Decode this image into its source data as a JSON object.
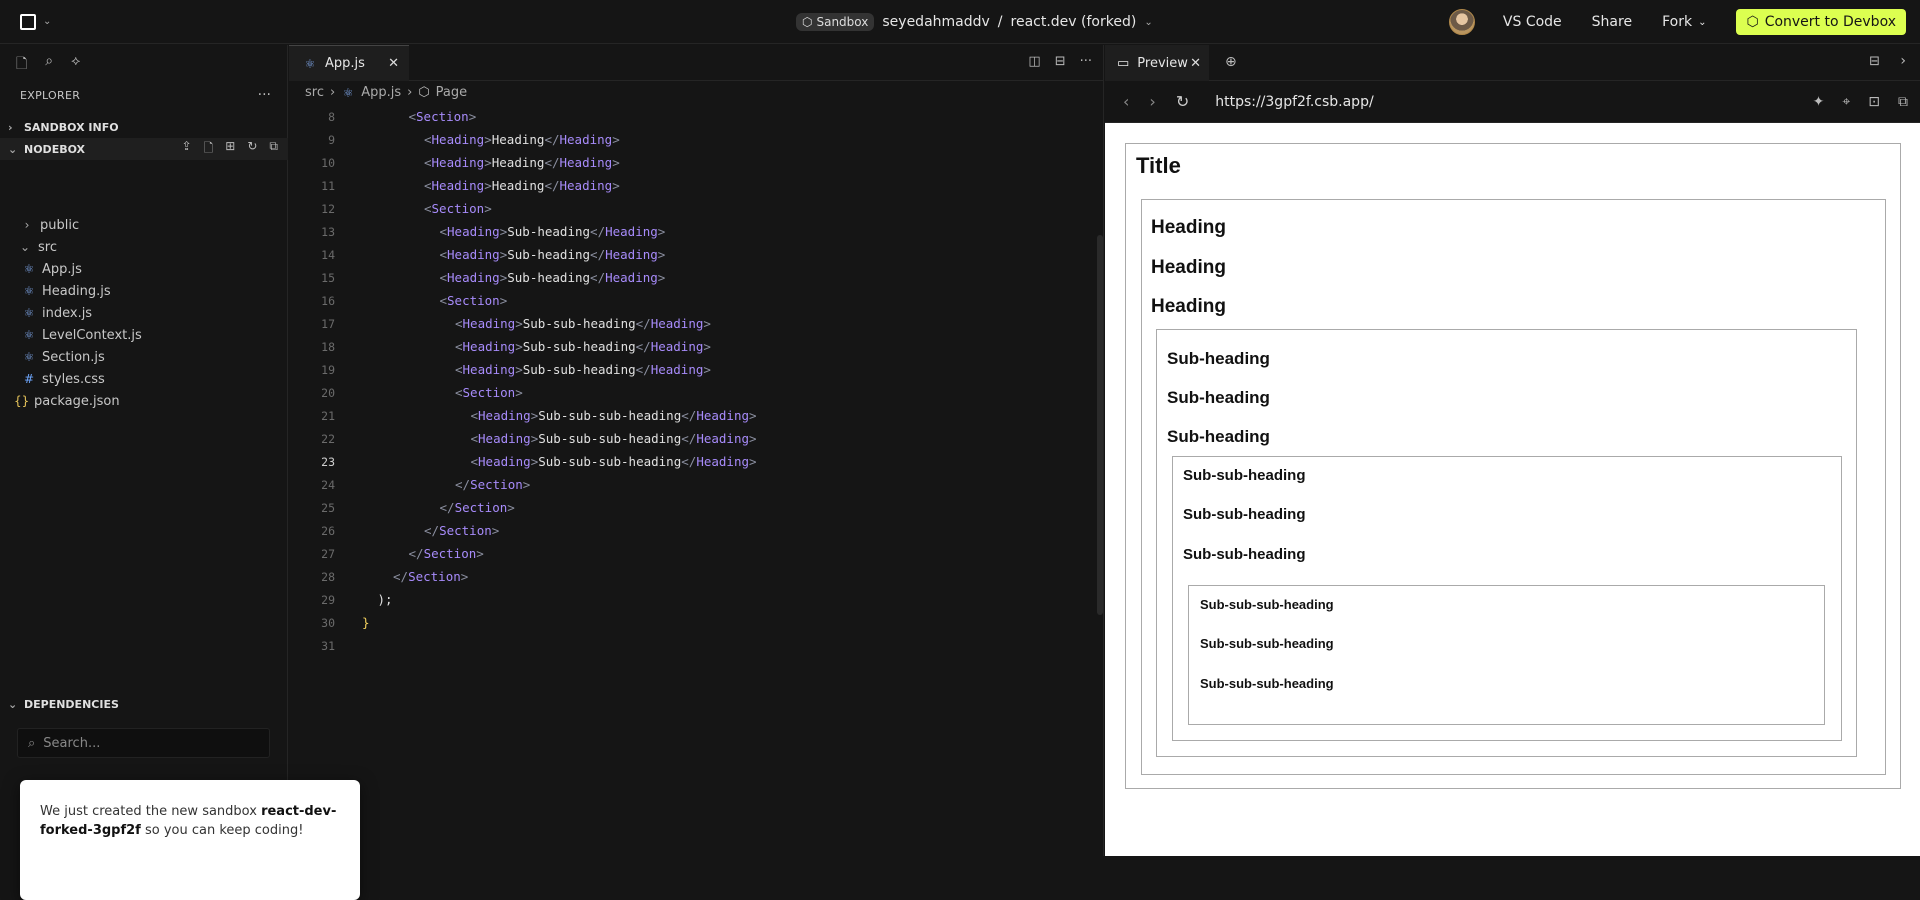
{
  "topbar": {
    "sandbox_label": "Sandbox",
    "owner": "seyedahmaddv",
    "separator": "/",
    "project": "react.dev (forked)",
    "vscode_label": "VS Code",
    "share_label": "Share",
    "fork_label": "Fork",
    "convert_label": "Convert to Devbox"
  },
  "sidebar": {
    "title": "EXPLORER",
    "sandbox_info": "SANDBOX INFO",
    "nodebox": "NODEBOX",
    "tree": [
      {
        "label": "public",
        "kind": "folder"
      },
      {
        "label": "src",
        "kind": "folder-open"
      },
      {
        "label": "App.js",
        "kind": "react"
      },
      {
        "label": "Heading.js",
        "kind": "react"
      },
      {
        "label": "index.js",
        "kind": "react"
      },
      {
        "label": "LevelContext.js",
        "kind": "react"
      },
      {
        "label": "Section.js",
        "kind": "react"
      },
      {
        "label": "styles.css",
        "kind": "css"
      },
      {
        "label": "package.json",
        "kind": "json"
      }
    ],
    "dependencies": "DEPENDENCIES",
    "search_placeholder": "Search..."
  },
  "toast": {
    "prefix": "We just created the new sandbox ",
    "name": "react-dev-forked-3gpf2f",
    "suffix": " so you can keep coding!"
  },
  "editor": {
    "tab_label": "App.js",
    "breadcrumb": [
      "src",
      "App.js",
      "Page"
    ],
    "current_line": 23,
    "lines": [
      {
        "n": 8,
        "indent": 3,
        "tag": "Section",
        "type": "open"
      },
      {
        "n": 9,
        "indent": 4,
        "tag": "Heading",
        "text": "Heading",
        "type": "pair"
      },
      {
        "n": 10,
        "indent": 4,
        "tag": "Heading",
        "text": "Heading",
        "type": "pair"
      },
      {
        "n": 11,
        "indent": 4,
        "tag": "Heading",
        "text": "Heading",
        "type": "pair"
      },
      {
        "n": 12,
        "indent": 4,
        "tag": "Section",
        "type": "open"
      },
      {
        "n": 13,
        "indent": 5,
        "tag": "Heading",
        "text": "Sub-heading",
        "type": "pair"
      },
      {
        "n": 14,
        "indent": 5,
        "tag": "Heading",
        "text": "Sub-heading",
        "type": "pair"
      },
      {
        "n": 15,
        "indent": 5,
        "tag": "Heading",
        "text": "Sub-heading",
        "type": "pair"
      },
      {
        "n": 16,
        "indent": 5,
        "tag": "Section",
        "type": "open"
      },
      {
        "n": 17,
        "indent": 6,
        "tag": "Heading",
        "text": "Sub-sub-heading",
        "type": "pair"
      },
      {
        "n": 18,
        "indent": 6,
        "tag": "Heading",
        "text": "Sub-sub-heading",
        "type": "pair"
      },
      {
        "n": 19,
        "indent": 6,
        "tag": "Heading",
        "text": "Sub-sub-heading",
        "type": "pair"
      },
      {
        "n": 20,
        "indent": 6,
        "tag": "Section",
        "type": "open"
      },
      {
        "n": 21,
        "indent": 7,
        "tag": "Heading",
        "text": "Sub-sub-sub-heading",
        "type": "pair"
      },
      {
        "n": 22,
        "indent": 7,
        "tag": "Heading",
        "text": "Sub-sub-sub-heading",
        "type": "pair"
      },
      {
        "n": 23,
        "indent": 7,
        "tag": "Heading",
        "text": "Sub-sub-sub-heading",
        "type": "pair"
      },
      {
        "n": 24,
        "indent": 6,
        "tag": "Section",
        "type": "close"
      },
      {
        "n": 25,
        "indent": 5,
        "tag": "Section",
        "type": "close"
      },
      {
        "n": 26,
        "indent": 4,
        "tag": "Section",
        "type": "close"
      },
      {
        "n": 27,
        "indent": 3,
        "tag": "Section",
        "type": "close"
      },
      {
        "n": 28,
        "indent": 2,
        "tag": "Section",
        "type": "close"
      },
      {
        "n": 29,
        "indent": 1,
        "raw": ");",
        "type": "raw"
      },
      {
        "n": 30,
        "indent": 0,
        "raw": "}",
        "type": "raw-yellow"
      },
      {
        "n": 31,
        "indent": 0,
        "raw": "",
        "type": "raw"
      }
    ]
  },
  "preview": {
    "tab_label": "Preview",
    "url": "https://3gpf2f.csb.app/",
    "title": "Title",
    "headings": [
      "Heading",
      "Heading",
      "Heading"
    ],
    "sub_headings": [
      "Sub-heading",
      "Sub-heading",
      "Sub-heading"
    ],
    "sub_sub_headings": [
      "Sub-sub-heading",
      "Sub-sub-heading",
      "Sub-sub-heading"
    ],
    "sub_sub_sub_headings": [
      "Sub-sub-sub-heading",
      "Sub-sub-sub-heading",
      "Sub-sub-sub-heading"
    ]
  }
}
